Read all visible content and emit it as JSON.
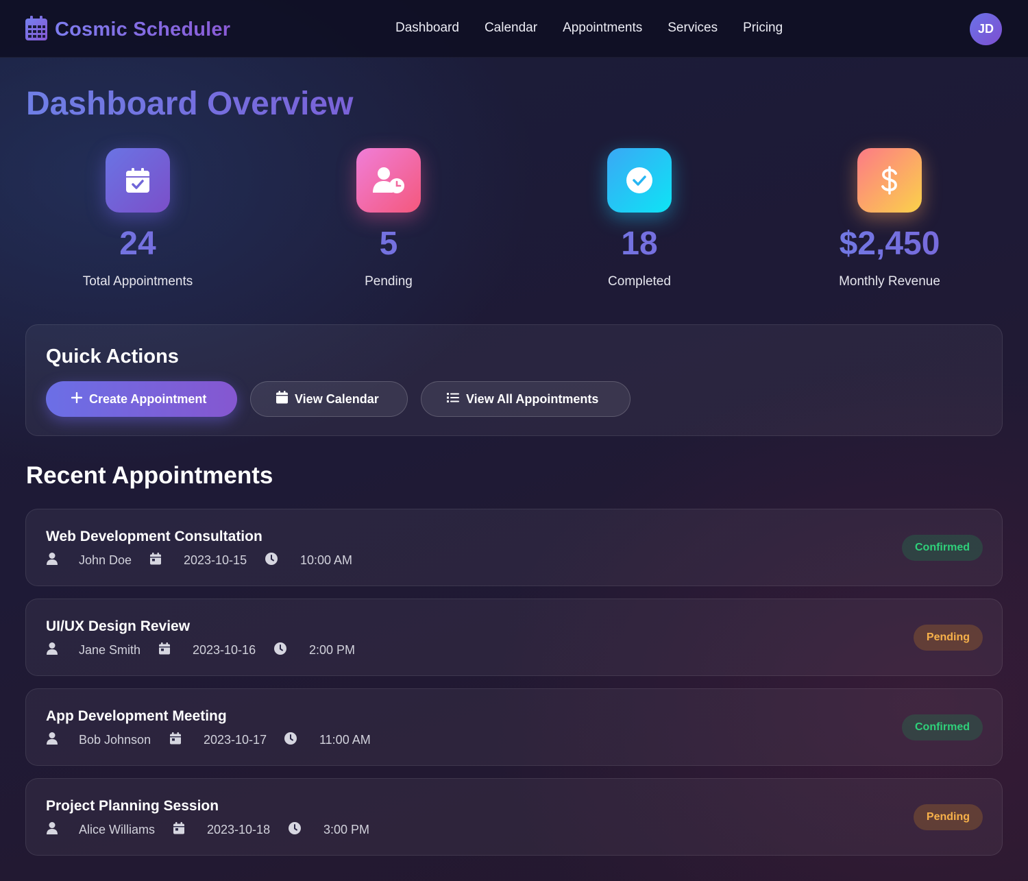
{
  "brand": {
    "title": "Cosmic Scheduler",
    "icon": "calendar-icon"
  },
  "nav": {
    "links": [
      "Dashboard",
      "Calendar",
      "Appointments",
      "Services",
      "Pricing"
    ]
  },
  "user": {
    "initials": "JD"
  },
  "page": {
    "title": "Dashboard Overview"
  },
  "stats": [
    {
      "value": "24",
      "label": "Total Appointments",
      "icon": "calendar-check-icon",
      "gradient": [
        "#6a74e4",
        "#7b4fc9"
      ]
    },
    {
      "value": "5",
      "label": "Pending",
      "icon": "user-clock-icon",
      "gradient": [
        "#f07ed8",
        "#f4587c"
      ]
    },
    {
      "value": "18",
      "label": "Completed",
      "icon": "check-circle-icon",
      "gradient": [
        "#3aa8f5",
        "#0ee4f5"
      ]
    },
    {
      "value": "$2,450",
      "label": "Monthly Revenue",
      "icon": "dollar-icon",
      "gradient": [
        "#fc7a86",
        "#fbd24a"
      ]
    }
  ],
  "quick_actions": {
    "title": "Quick Actions",
    "buttons": [
      {
        "label": "Create Appointment",
        "icon": "plus-icon"
      },
      {
        "label": "View Calendar",
        "icon": "calendar-icon"
      },
      {
        "label": "View All Appointments",
        "icon": "list-icon"
      }
    ]
  },
  "recent": {
    "title": "Recent Appointments",
    "items": [
      {
        "title": "Web Development Consultation",
        "client": "John Doe",
        "date": "2023-10-15",
        "time": "10:00 AM",
        "status": "Confirmed"
      },
      {
        "title": "UI/UX Design Review",
        "client": "Jane Smith",
        "date": "2023-10-16",
        "time": "2:00 PM",
        "status": "Pending"
      },
      {
        "title": "App Development Meeting",
        "client": "Bob Johnson",
        "date": "2023-10-17",
        "time": "11:00 AM",
        "status": "Confirmed"
      },
      {
        "title": "Project Planning Session",
        "client": "Alice Williams",
        "date": "2023-10-18",
        "time": "3:00 PM",
        "status": "Pending"
      }
    ]
  },
  "colors": {
    "confirmed": "#2fd07a",
    "pending": "#f7b14a",
    "accent": "#6f7fe6"
  }
}
